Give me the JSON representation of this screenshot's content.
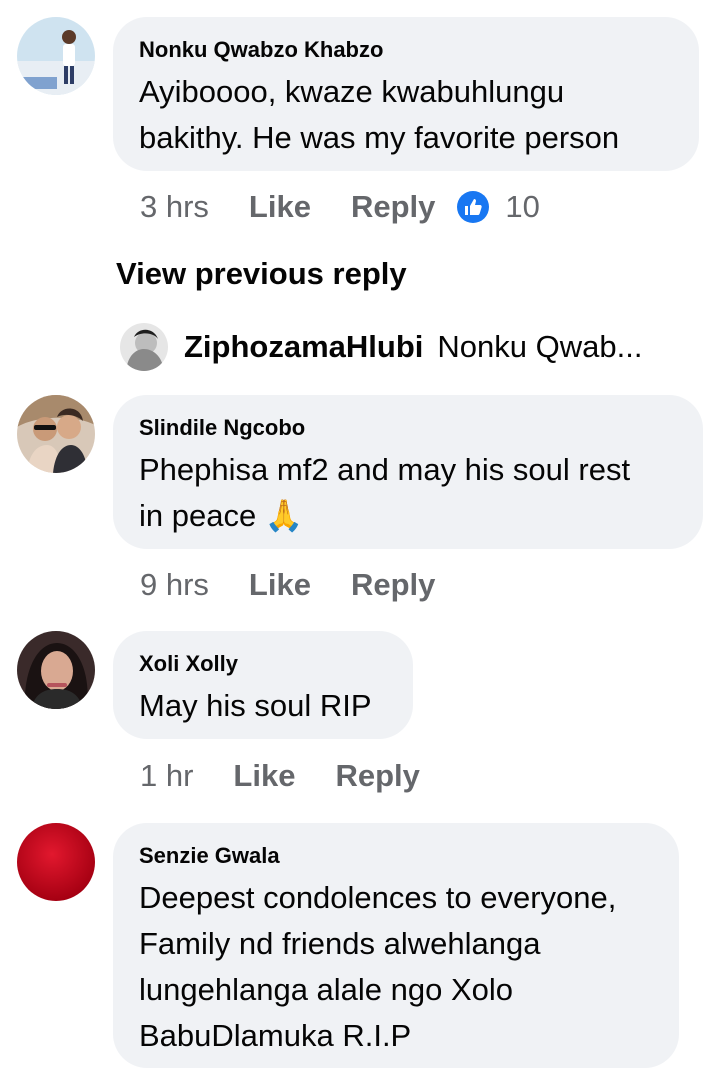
{
  "comments": [
    {
      "author": "Nonku Qwabzo Khabzo",
      "text": "Ayiboooo,  kwaze kwabuhlungu\nbakithy.  He was my favorite person",
      "time": "3 hrs",
      "like_label": "Like",
      "reply_label": "Reply",
      "reaction_count": "10",
      "reaction_icon": "like-thumb-icon"
    },
    {
      "author": "Slindile Ngcobo",
      "text": "Phephisa mf2 and may his soul rest\nin peace 🙏",
      "time": "9 hrs",
      "like_label": "Like",
      "reply_label": "Reply"
    },
    {
      "author": "Xoli Xolly",
      "text": "May his soul RIP",
      "time": "1 hr",
      "like_label": "Like",
      "reply_label": "Reply"
    },
    {
      "author": "Senzie Gwala",
      "text": "Deepest condolences to everyone,\nFamily nd friends alwehlanga\nlungehlanga alale ngo Xolo\nBabuDlamuka R.I.P"
    }
  ],
  "view_previous_reply": "View previous reply",
  "reply_preview": {
    "author": "ZiphozamaHlubi",
    "text": "Nonku Qwab..."
  },
  "colors": {
    "bubble": "#f0f2f5",
    "meta_text": "#65676b",
    "like_blue": "#1877f2",
    "senzie_avatar": "#c8102e"
  }
}
